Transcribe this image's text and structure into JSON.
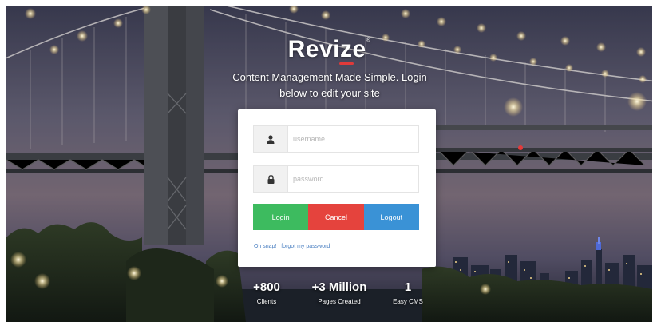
{
  "brand": {
    "name_prefix": "Revi",
    "name_z": "z",
    "name_suffix": "e",
    "reg_mark": "®",
    "accent_color": "#e03a3a"
  },
  "tagline": "Content Management Made Simple. Login below to edit your site",
  "login": {
    "username_placeholder": "username",
    "password_placeholder": "password",
    "username_icon": "user-icon",
    "password_icon": "lock-icon",
    "buttons": {
      "login_label": "Login",
      "cancel_label": "Cancel",
      "logout_label": "Logout"
    },
    "forgot_link": "Oh snap! I forgot my password"
  },
  "colors": {
    "login": "#3dbb5f",
    "cancel": "#e5433d",
    "logout": "#3a92d6",
    "link": "#4a7fc1"
  },
  "stats": [
    {
      "value": "+800",
      "label": "Clients"
    },
    {
      "value": "+3 Million",
      "label": "Pages Created"
    },
    {
      "value": "1",
      "label": "Easy CMS"
    }
  ]
}
